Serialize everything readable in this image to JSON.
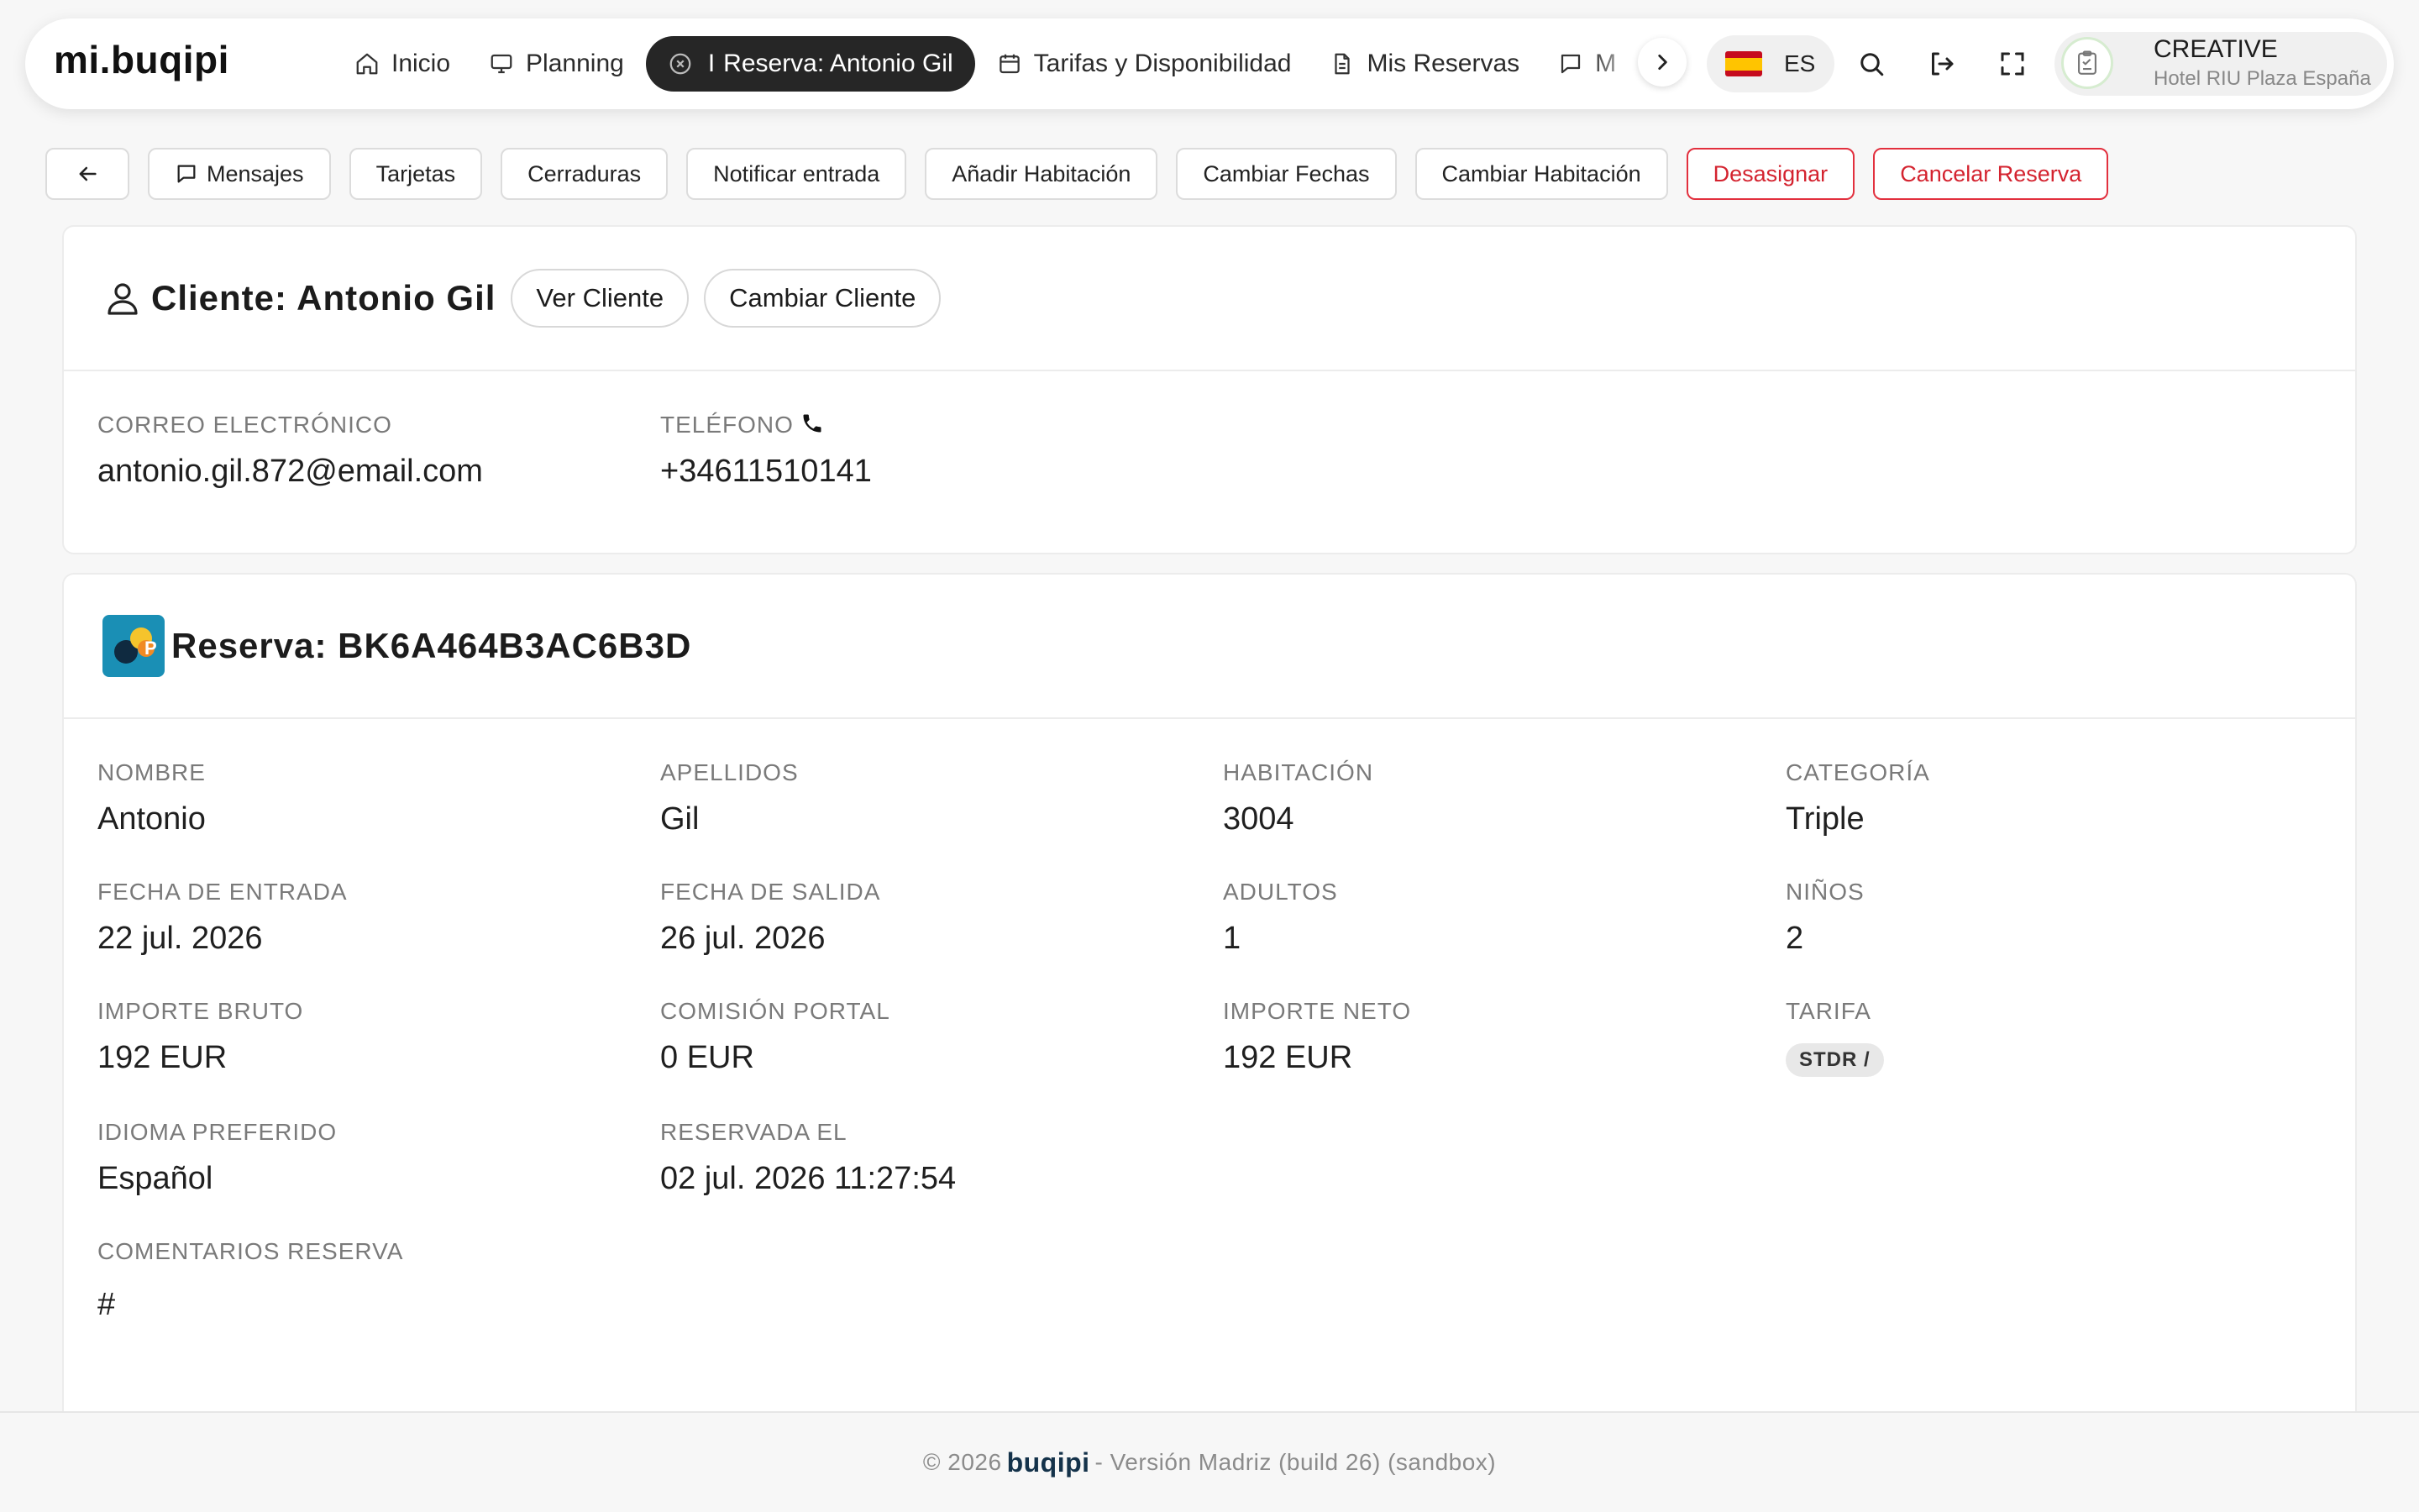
{
  "app": {
    "logo": "mi.buqipi"
  },
  "nav": {
    "items": [
      {
        "label": "Inicio",
        "icon": "home-icon"
      },
      {
        "label": "Planning",
        "icon": "monitor-icon"
      },
      {
        "label": "Reserva: Antonio Gil",
        "icon": "close-circle-icon",
        "active": true,
        "separator": "I"
      },
      {
        "label": "Tarifas y Disponibilidad",
        "icon": "calendar-icon"
      },
      {
        "label": "Mis Reservas",
        "icon": "document-icon"
      },
      {
        "label": "M",
        "icon": "message-icon"
      }
    ],
    "scroll_icon": "chevron-right-icon"
  },
  "language": {
    "code": "ES",
    "flag": "spain-flag-icon"
  },
  "header_actions": [
    "search-icon",
    "logout-icon",
    "fullscreen-icon"
  ],
  "profile": {
    "name": "CREATIVE",
    "hotel": "Hotel RIU Plaza España",
    "icon": "clipboard-avatar-icon"
  },
  "toolbar": {
    "back_icon": "arrow-left-icon",
    "buttons": [
      {
        "label": "Mensajes",
        "icon": "message-icon"
      },
      {
        "label": "Tarjetas"
      },
      {
        "label": "Cerraduras"
      },
      {
        "label": "Notificar entrada"
      },
      {
        "label": "Añadir Habitación"
      },
      {
        "label": "Cambiar Fechas"
      },
      {
        "label": "Cambiar Habitación"
      },
      {
        "label": "Desasignar",
        "style": "danger"
      },
      {
        "label": "Cancelar Reserva",
        "style": "danger"
      }
    ],
    "danger_color": "#d4232f"
  },
  "client": {
    "title": "Cliente: Antonio Gil",
    "view_button": "Ver Cliente",
    "change_button": "Cambiar Cliente",
    "email_label": "CORREO ELECTRÓNICO",
    "email": "antonio.gil.872@email.com",
    "phone_label": "TELÉFONO",
    "phone": "+34611510141"
  },
  "booking": {
    "title": "Reserva: BK6A464B3AC6B3D",
    "fields": {
      "nombre": {
        "label": "NOMBRE",
        "value": "Antonio"
      },
      "apellidos": {
        "label": "APELLIDOS",
        "value": "Gil"
      },
      "habitacion": {
        "label": "HABITACIÓN",
        "value": "3004"
      },
      "categoria": {
        "label": "CATEGORÍA",
        "value": "Triple"
      },
      "entrada": {
        "label": "FECHA DE ENTRADA",
        "value": "22 jul. 2026"
      },
      "salida": {
        "label": "FECHA DE SALIDA",
        "value": "26 jul. 2026"
      },
      "adultos": {
        "label": "ADULTOS",
        "value": "1"
      },
      "ninos": {
        "label": "NIÑOS",
        "value": "2"
      },
      "bruto": {
        "label": "IMPORTE BRUTO",
        "value": "192 EUR"
      },
      "comision": {
        "label": "COMISIÓN PORTAL",
        "value": "0 EUR"
      },
      "neto": {
        "label": "IMPORTE NETO",
        "value": "192 EUR"
      },
      "tarifa": {
        "label": "TARIFA",
        "value": "STDR /"
      },
      "idioma": {
        "label": "IDIOMA PREFERIDO",
        "value": "Español"
      },
      "reservada": {
        "label": "RESERVADA EL",
        "value": "02 jul. 2026 11:27:54"
      },
      "comentarios": {
        "label": "COMENTARIOS RESERVA",
        "value": "#"
      }
    }
  },
  "footer": {
    "prefix": "© 2026",
    "brand": "buqipi",
    "suffix": "- Versión Madriz (build 26) (sandbox)"
  }
}
